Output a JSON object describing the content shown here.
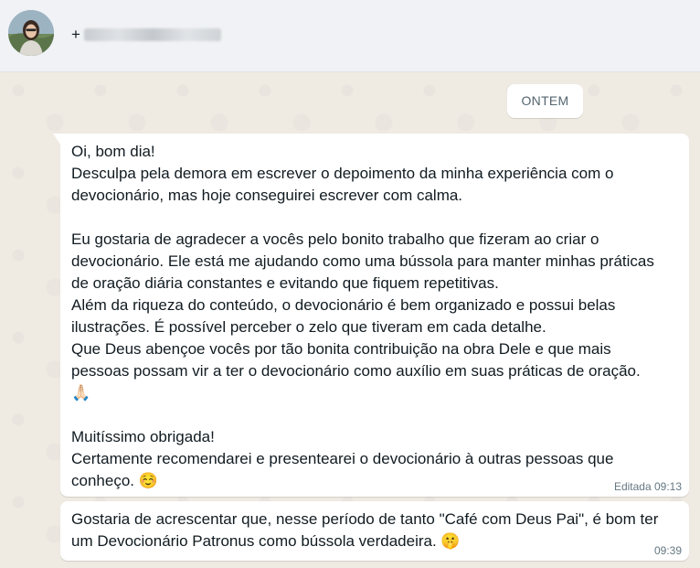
{
  "header": {
    "contact_prefix": "+",
    "avatar": "profile-photo"
  },
  "date_divider": "ONTEM",
  "messages": [
    {
      "lines": [
        "Oi, bom dia!",
        "Desculpa pela demora em escrever o depoimento da minha experiência com o",
        "devocionário, mas hoje conseguirei escrever com calma.",
        "",
        "Eu gostaria de agradecer a vocês pelo bonito trabalho que fizeram ao criar o",
        "devocionário. Ele está me ajudando como uma bússola para manter minhas práticas",
        "de oração diária constantes e evitando que fiquem repetitivas.",
        "Além da riqueza do conteúdo, o devocionário é bem organizado e possui belas",
        "ilustrações. É possível perceber o zelo que tiveram em cada detalhe.",
        "Que Deus abençoe vocês por tão bonita contribuição na obra Dele e que mais",
        "pessoas possam vir a ter o devocionário como auxílio em suas práticas de oração.",
        "🙏🏻",
        "",
        "Muitíssimo obrigada!",
        "Certamente recomendarei e presentearei o devocionário à outras pessoas que",
        "conheço. ☺️"
      ],
      "meta": "Editada 09:13"
    },
    {
      "lines": [
        "Gostaria de acrescentar que, nesse período de tanto \"Café com Deus Pai\", é bom ter",
        "um Devocionário Patronus como bússola verdadeira. 🤫"
      ],
      "meta": "09:39"
    }
  ]
}
